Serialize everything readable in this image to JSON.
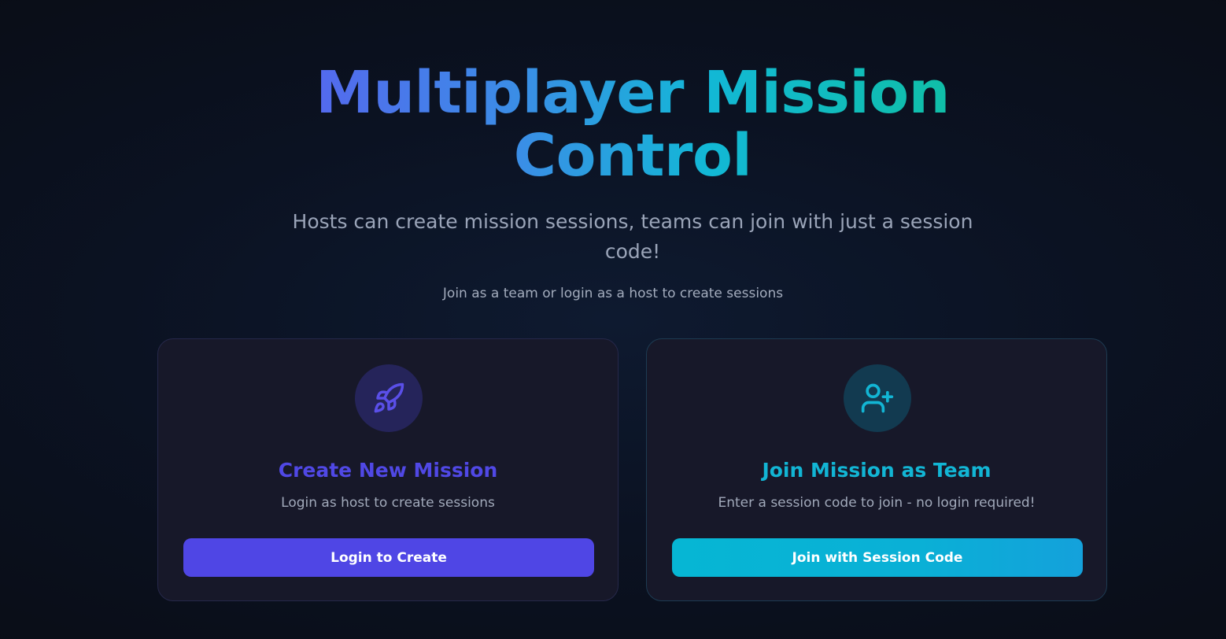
{
  "hero": {
    "title": "Multiplayer Mission Control",
    "subtitle": "Hosts can create mission sessions, teams can join with just a session code!",
    "hint": "Join as a team or login as a host to create sessions"
  },
  "cards": {
    "create": {
      "icon": "rocket-icon",
      "title": "Create New Mission",
      "description": "Login as host to create sessions",
      "button_label": "Login to Create",
      "accent": "#4f46e5"
    },
    "join": {
      "icon": "user-plus-icon",
      "title": "Join Mission as Team",
      "description": "Enter a session code to join - no login required!",
      "button_label": "Join with Session Code",
      "accent": "#06b6d4"
    }
  }
}
